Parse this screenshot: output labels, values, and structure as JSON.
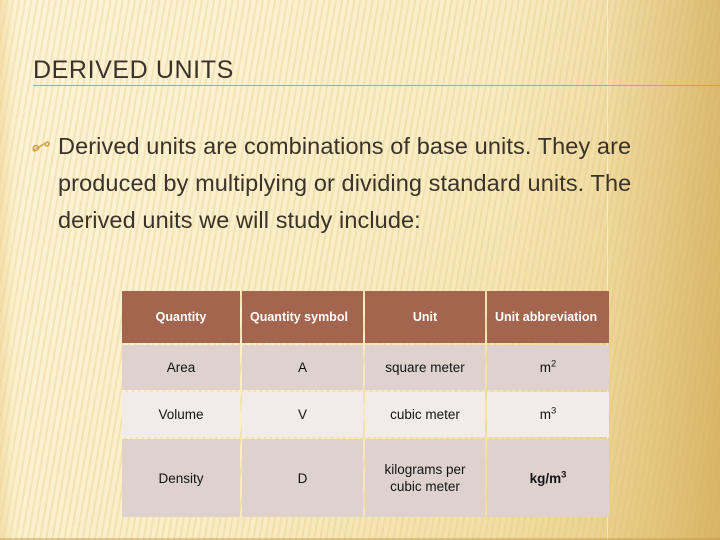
{
  "slide": {
    "title": "DERIVED UNITS",
    "bullet_icon": "script-flourish-bullet-icon",
    "body_text": "Derived units are combinations of base units. They are produced by multiplying or dividing standard units. The derived units we will study include:"
  },
  "colors": {
    "title_text": "#3b3229",
    "title_rule": "#d9a13c",
    "body_text": "#3b3229",
    "bullet": "#d4a24a",
    "table_header_bg": "#a4654f",
    "table_header_text": "#ffffff",
    "row_shade_dark": "#ded1ce",
    "row_shade_light": "#f1ecea",
    "background_light": "#fcf4d8",
    "background_dark": "#eacf87"
  },
  "table": {
    "headers": [
      {
        "label": "Quantity",
        "align": "center"
      },
      {
        "label": "Quantity symbol",
        "align": "left"
      },
      {
        "label": "Unit",
        "align": "center"
      },
      {
        "label": "Unit abbreviation",
        "align": "left"
      }
    ],
    "rows": [
      {
        "shade": "dark",
        "quantity": "Area",
        "symbol": "A",
        "unit": "square meter",
        "abbrev_base": "m",
        "abbrev_sup": "2"
      },
      {
        "shade": "light",
        "quantity": "Volume",
        "symbol": "V",
        "unit": "cubic meter",
        "abbrev_base": "m",
        "abbrev_sup": "3"
      },
      {
        "shade": "dark",
        "quantity": "Density",
        "symbol": "D",
        "unit": "kilograms per cubic meter",
        "abbrev_base": "kg/m",
        "abbrev_sup": "3"
      }
    ]
  }
}
